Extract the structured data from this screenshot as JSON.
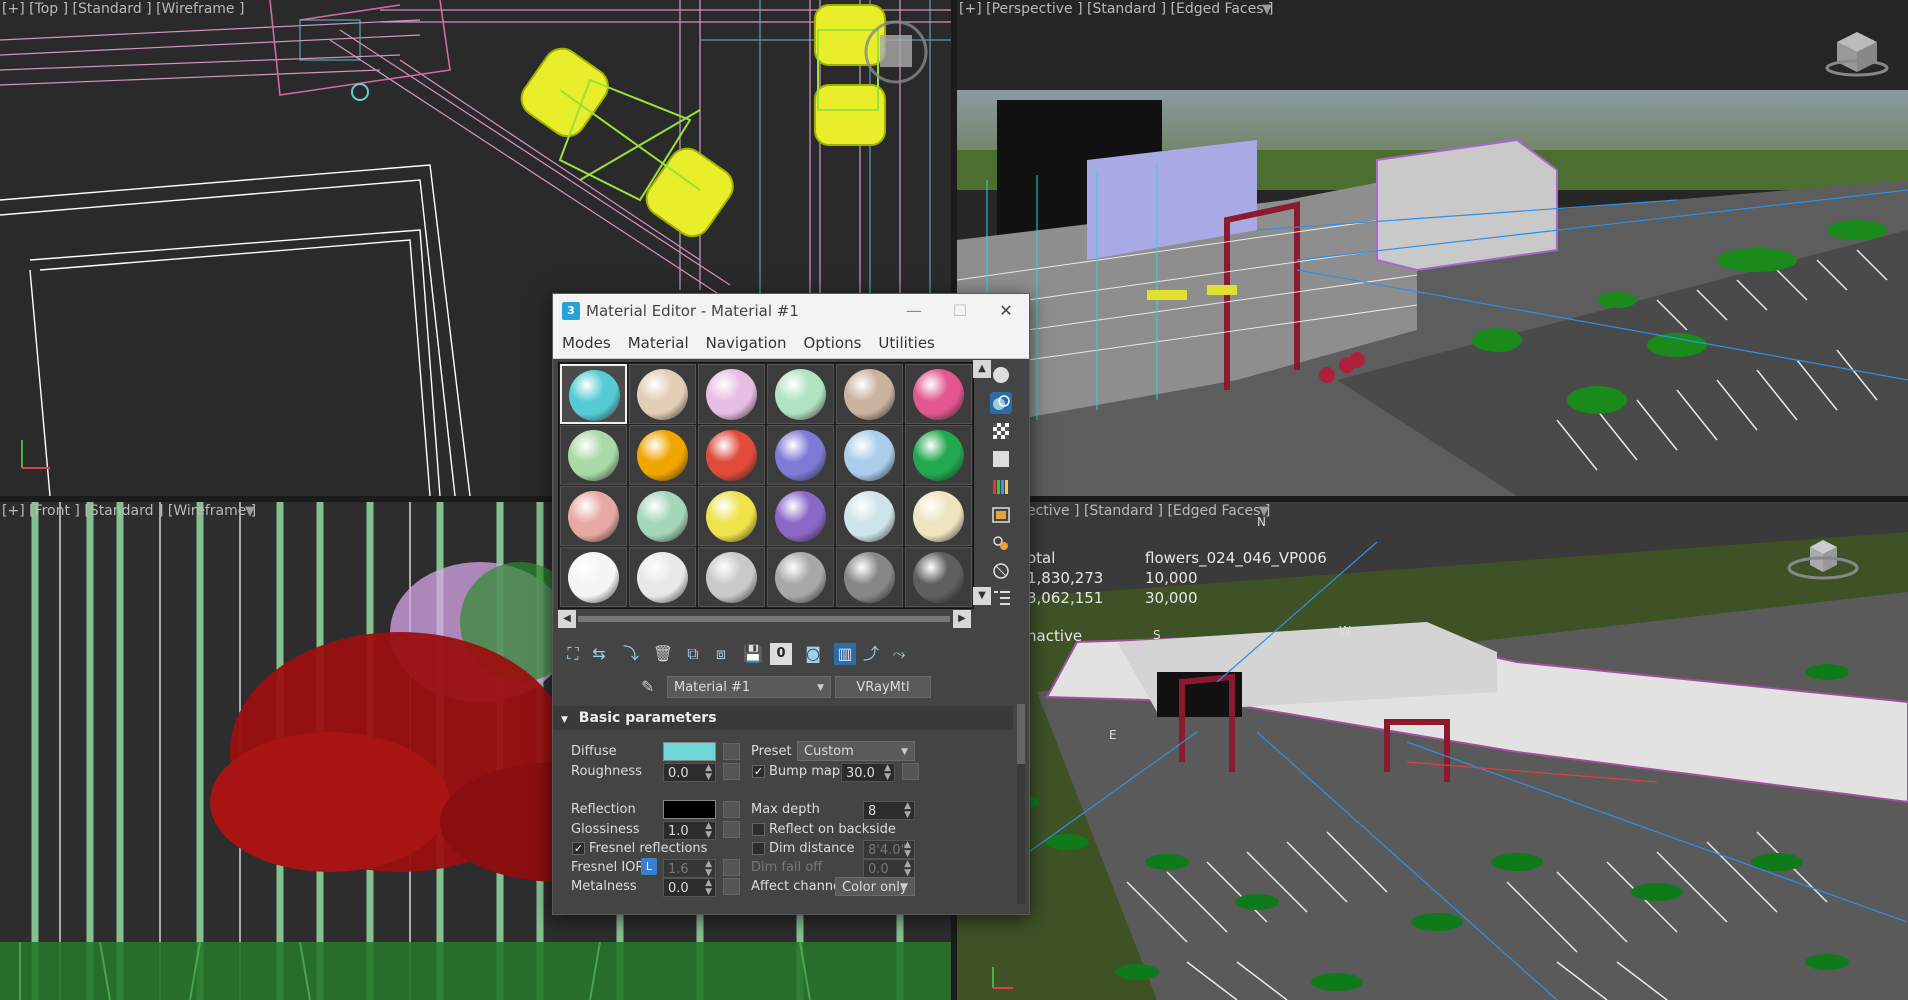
{
  "viewports": {
    "top": {
      "label": "[+] [Top ] [Standard ] [Wireframe ]"
    },
    "perspective": {
      "label": "[+] [Perspective ] [Standard ] [Edged Faces ]"
    },
    "front": {
      "label": "[+] [Front ] [Standard ] [Wireframe ]"
    },
    "perspective2": {
      "label": "[+] [Perspective ] [Standard ] [Edged Faces ]",
      "label_visible": "ective ] [Standard ] [Edged Faces ]"
    }
  },
  "stats": {
    "col1": [
      "otal",
      "1,830,273",
      "3,062,151"
    ],
    "col2": [
      "flowers_024_046_VP006",
      "10,000",
      "30,000"
    ],
    "inactive": "nactive"
  },
  "material_editor": {
    "title": "Material Editor - Material #1",
    "app_icon": "3",
    "window_buttons": {
      "minimize": "—",
      "maximize": "☐",
      "close": "✕"
    },
    "menu": [
      "Modes",
      "Material",
      "Navigation",
      "Options",
      "Utilities"
    ],
    "slots": [
      [
        "#55ccd4",
        "#e2cdb6",
        "#e8bde3",
        "#b0e3c2",
        "#c9b29e",
        "#e2578f"
      ],
      [
        "#a9d9a6",
        "#f0a500",
        "#e04b3a",
        "#7e7ad6",
        "#a9cdea",
        "#22a94f"
      ],
      [
        "#e8a8a3",
        "#a5d6bb",
        "#efe24a",
        "#8a68c8",
        "#cfe3ea",
        "#efe4c0"
      ],
      [
        "#f5f5f5",
        "#e8e8e8",
        "#c9c9c9",
        "#a8a8a8",
        "#878787",
        "#5f5f5f"
      ]
    ],
    "material_name": "Material #1",
    "material_type": "VRayMtl",
    "toolbar_zero": "0",
    "rollout_title": "Basic parameters",
    "params": {
      "diffuse_label": "Diffuse",
      "diffuse_color": "#6fd6da",
      "preset_label": "Preset",
      "preset_value": "Custom",
      "roughness_label": "Roughness",
      "roughness_value": "0.0",
      "bump_label": "Bump map",
      "bump_value": "30.0",
      "bump_checked": true,
      "reflection_label": "Reflection",
      "reflection_color": "#000000",
      "max_depth_label": "Max depth",
      "max_depth_value": "8",
      "glossiness_label": "Glossiness",
      "glossiness_value": "1.0",
      "reflect_backside_label": "Reflect on backside",
      "fresnel_label": "Fresnel reflections",
      "fresnel_checked": true,
      "dim_distance_label": "Dim distance",
      "dim_distance_value": "8'4.0\"",
      "fresnel_ior_label": "Fresnel IOR",
      "fresnel_ior_lock": "L",
      "fresnel_ior_value": "1.6",
      "dim_falloff_label": "Dim fall off",
      "dim_falloff_value": "0.0",
      "metalness_label": "Metalness",
      "metalness_value": "0.0",
      "affect_channels_label": "Affect channels",
      "affect_channels_value": "Color only"
    }
  },
  "compass": {
    "letters": [
      "N",
      "W",
      "S",
      "E"
    ]
  }
}
